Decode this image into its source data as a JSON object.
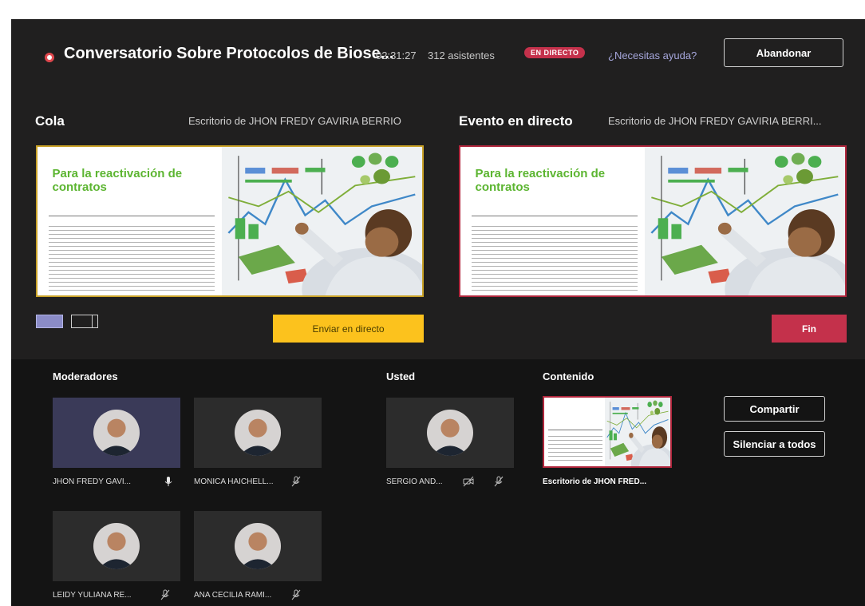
{
  "header": {
    "title": "Conversatorio Sobre Protocolos de Biose...",
    "duration": "02:31:27",
    "attendees": "312 asistentes",
    "live_badge": "EN DIRECTO",
    "help_link": "¿Necesitas ayuda?",
    "leave_button": "Abandonar"
  },
  "queue": {
    "title": "Cola",
    "source": "Escritorio de JHON FREDY GAVIRIA BERRIO",
    "slide_title": "Para la reactivación de contratos",
    "send_button": "Enviar en directo"
  },
  "live": {
    "title": "Evento en directo",
    "source": "Escritorio de JHON FREDY GAVIRIA BERRI...",
    "slide_title": "Para la reactivación de contratos",
    "end_button": "Fin"
  },
  "sections": {
    "moderators": "Moderadores",
    "you": "Usted",
    "content": "Contenido"
  },
  "moderators": [
    {
      "name": "JHON FREDY GAVI..."
    },
    {
      "name": "MONICA HAICHELL..."
    },
    {
      "name": "LEIDY YULIANA RE..."
    },
    {
      "name": "ANA CECILIA RAMI..."
    }
  ],
  "you": {
    "name": "SERGIO AND..."
  },
  "content": {
    "label": "Escritorio de JHON FRED..."
  },
  "actions": {
    "share": "Compartir",
    "mute_all": "Silenciar a todos"
  },
  "colors": {
    "accent_purple": "#8b8cc7",
    "live_red": "#c4314b",
    "send_yellow": "#fcc21d",
    "slide_green": "#5cb531",
    "queue_border": "#c9a227"
  },
  "icons": [
    "record-icon",
    "single-view-icon",
    "split-view-icon",
    "mic-icon",
    "mic-off-icon",
    "camera-off-icon"
  ]
}
